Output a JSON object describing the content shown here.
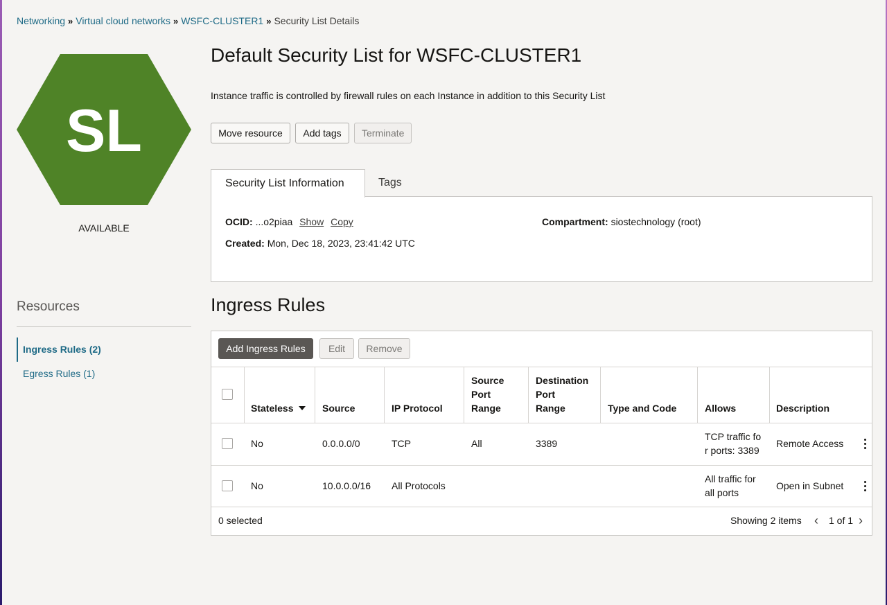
{
  "breadcrumb": {
    "items": [
      "Networking",
      "Virtual cloud networks",
      "WSFC-CLUSTER1"
    ],
    "current": "Security List Details"
  },
  "badge": {
    "initials": "SL",
    "status": "AVAILABLE",
    "color": "#4f8327"
  },
  "header": {
    "title": "Default Security List for WSFC-CLUSTER1",
    "description": "Instance traffic is controlled by firewall rules on each Instance in addition to this Security List"
  },
  "actions": {
    "move": "Move resource",
    "tags": "Add tags",
    "terminate": "Terminate"
  },
  "tabs": {
    "info": "Security List Information",
    "tags": "Tags"
  },
  "info": {
    "ocid_label": "OCID:",
    "ocid_value": "...o2piaa",
    "show": "Show",
    "copy": "Copy",
    "created_label": "Created:",
    "created_value": "Mon, Dec 18, 2023, 23:41:42 UTC",
    "compartment_label": "Compartment:",
    "compartment_value": "siostechnology (root)"
  },
  "resources": {
    "title": "Resources",
    "items": [
      "Ingress Rules (2)",
      "Egress Rules (1)"
    ]
  },
  "ingress": {
    "title": "Ingress Rules",
    "add": "Add Ingress Rules",
    "edit": "Edit",
    "remove": "Remove",
    "columns": {
      "stateless": "Stateless",
      "source": "Source",
      "protocol": "IP Protocol",
      "source_port": [
        "Source",
        "Port",
        "Range"
      ],
      "dest_port": [
        "Destination",
        "Port",
        "Range"
      ],
      "type_code": "Type and Code",
      "allows": "Allows",
      "description": "Description"
    },
    "rows": [
      {
        "stateless": "No",
        "source": "0.0.0.0/0",
        "protocol": "TCP",
        "source_port": "All",
        "dest_port": "3389",
        "type_code": "",
        "allows": [
          "TCP traffic fo",
          "r ports: 3389"
        ],
        "description": "Remote Access"
      },
      {
        "stateless": "No",
        "source": "10.0.0.0/16",
        "protocol": "All Protocols",
        "source_port": "",
        "dest_port": "",
        "type_code": "",
        "allows": [
          "All traffic for",
          "all ports"
        ],
        "description": "Open in Subnet"
      }
    ],
    "selected": "0 selected",
    "showing": "Showing 2 items",
    "page": "1 of 1"
  }
}
